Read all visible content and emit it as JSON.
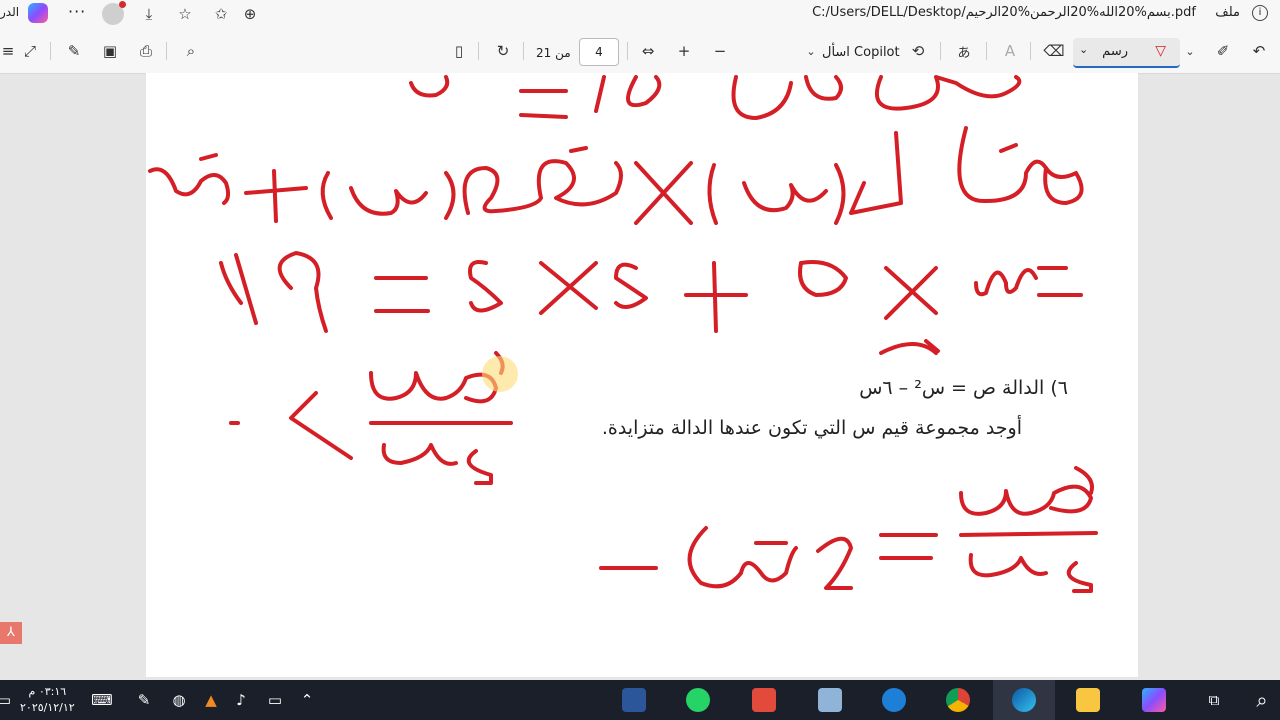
{
  "browser": {
    "left_label": "الدر",
    "url": "C:/Users/DELL/Desktop/بسم%20الله%20الرحمن%20الرحيم.pdf",
    "file_label": "ملف",
    "icons": [
      "copilot-icon",
      "more-icon",
      "profile-icon",
      "download-icon",
      "favorites-icon",
      "add-favorite-icon",
      "zoom-icon",
      "info-icon"
    ]
  },
  "toolbar": {
    "page_current": "4",
    "page_total": "من 21",
    "ask_copilot": "اسأل Copilot",
    "draw_label": "رسم"
  },
  "document": {
    "q6_line": "٦)   الدالة ص = س² – ٦س",
    "q6_prompt": "أوجد مجموعة قيم  س  التي تكون عندها الدالة متزايدة."
  },
  "taskbar": {
    "time": "٠٣:١٦ م",
    "date": "٢٠٢٥/١٢/١٢"
  },
  "colors": {
    "ink": "#d41f26",
    "accent": "#2468c0"
  }
}
